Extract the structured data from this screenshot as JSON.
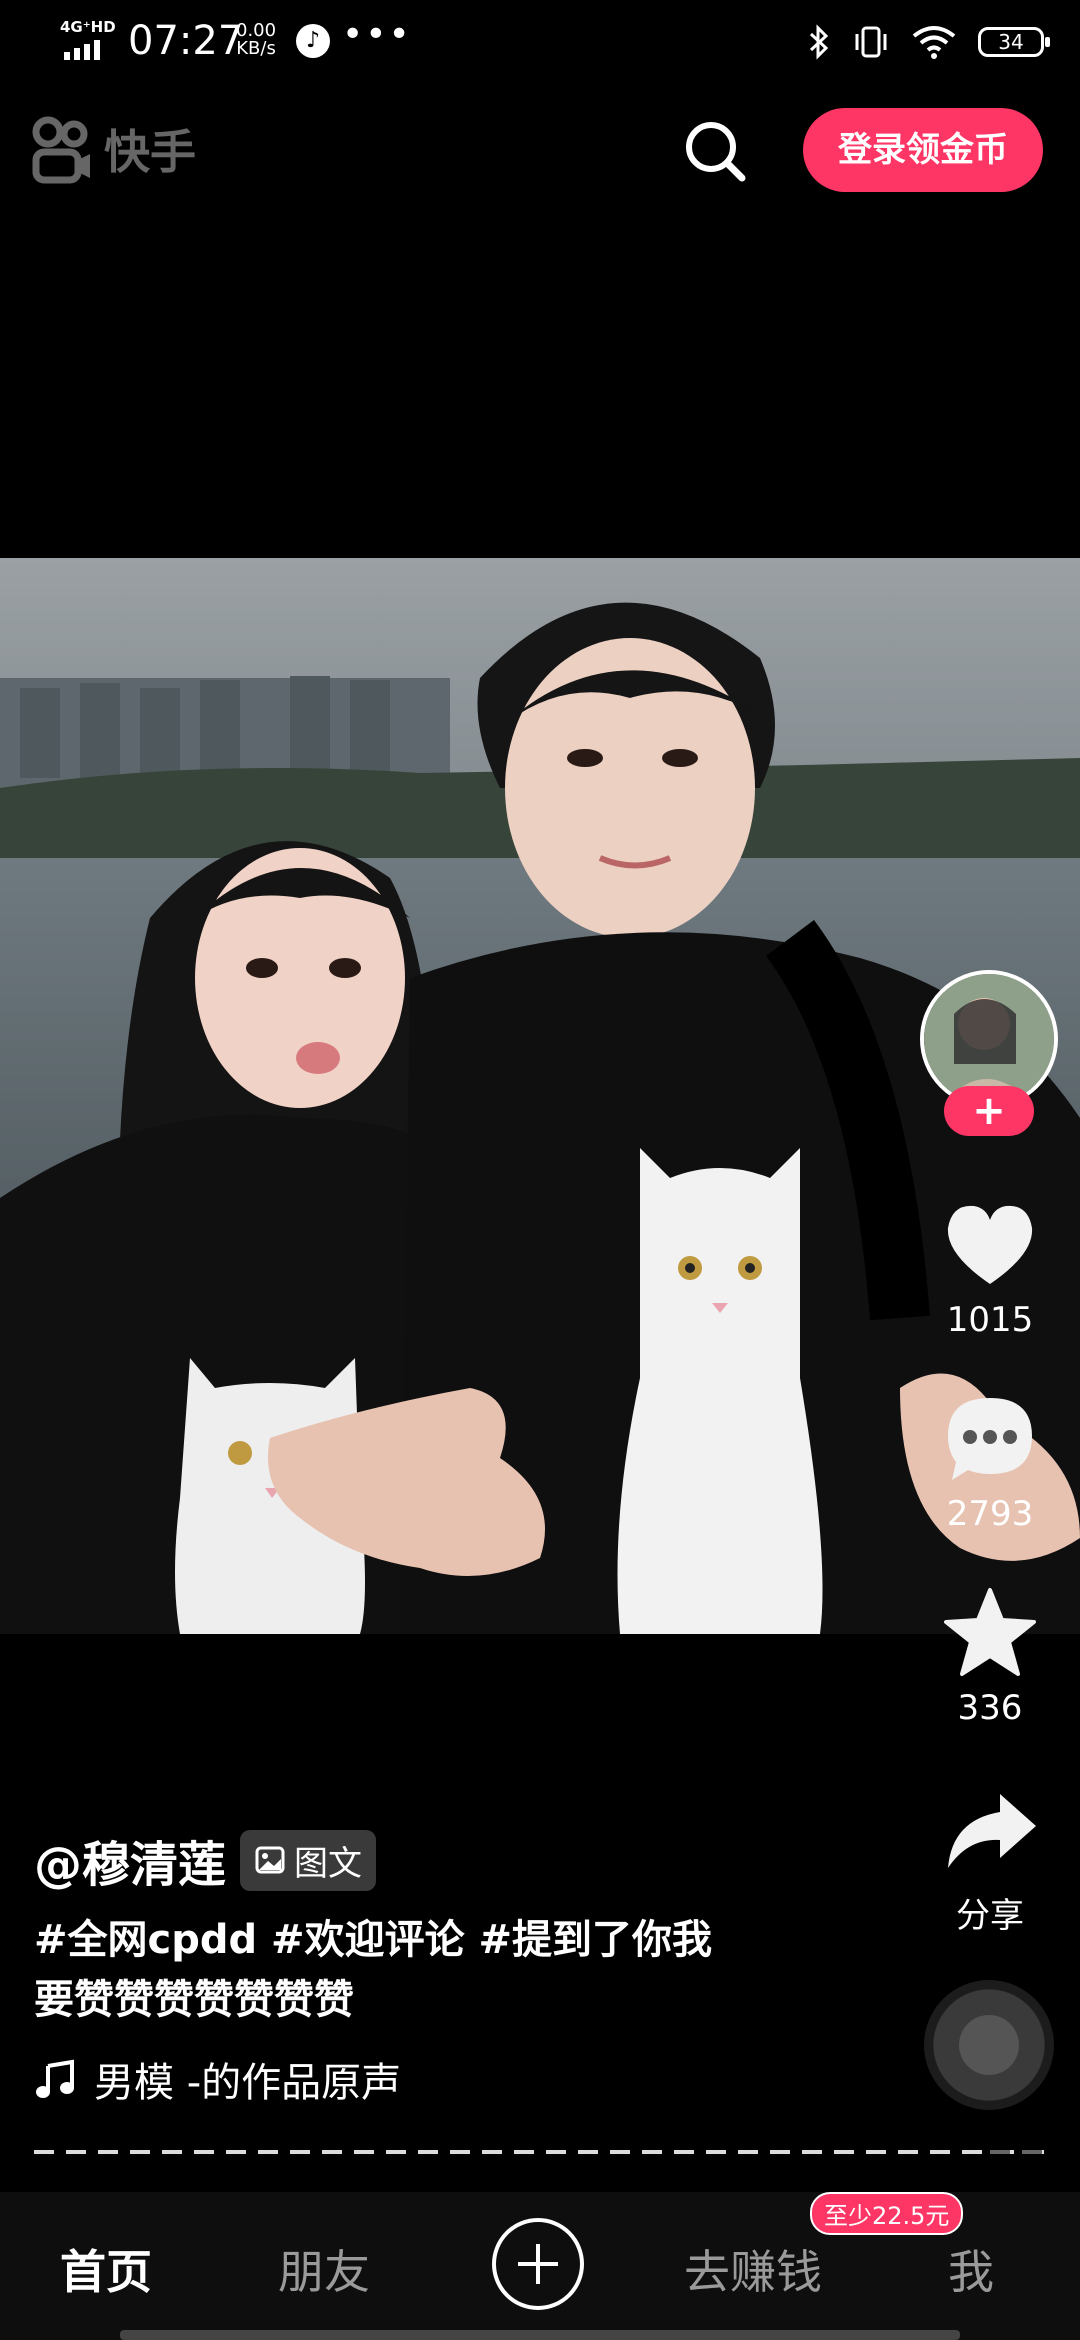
{
  "status_bar": {
    "network": "4G⁺HD",
    "time": "07:27",
    "speed_value": "0.00",
    "speed_unit": "KB/s",
    "more": "•••",
    "battery": "34"
  },
  "header": {
    "app_name": "快手",
    "login_button": "登录领金币"
  },
  "post": {
    "author": "@穆清莲",
    "type_badge": "图文",
    "caption_line1": "#全网cpdd #欢迎评论 #提到了你我",
    "caption_line2": "要赞赞赞赞赞赞赞",
    "music": "男模 -的作品原声",
    "follow_symbol": "+"
  },
  "actions": {
    "likes": "1015",
    "comments": "2793",
    "favorites": "336",
    "share_label": "分享"
  },
  "nav": {
    "home": "首页",
    "friends": "朋友",
    "earn": "去赚钱",
    "earn_badge": "至少22.5元",
    "me": "我"
  },
  "colors": {
    "accent": "#fe3666",
    "background": "#000000",
    "navbar": "#0e0e0e"
  },
  "icons": [
    "kuaishou-logo-icon",
    "search-icon",
    "heart-icon",
    "comment-icon",
    "star-icon",
    "share-icon",
    "music-note-icon",
    "plus-icon",
    "image-icon",
    "bluetooth-icon",
    "vibrate-icon",
    "wifi-icon",
    "battery-icon"
  ]
}
